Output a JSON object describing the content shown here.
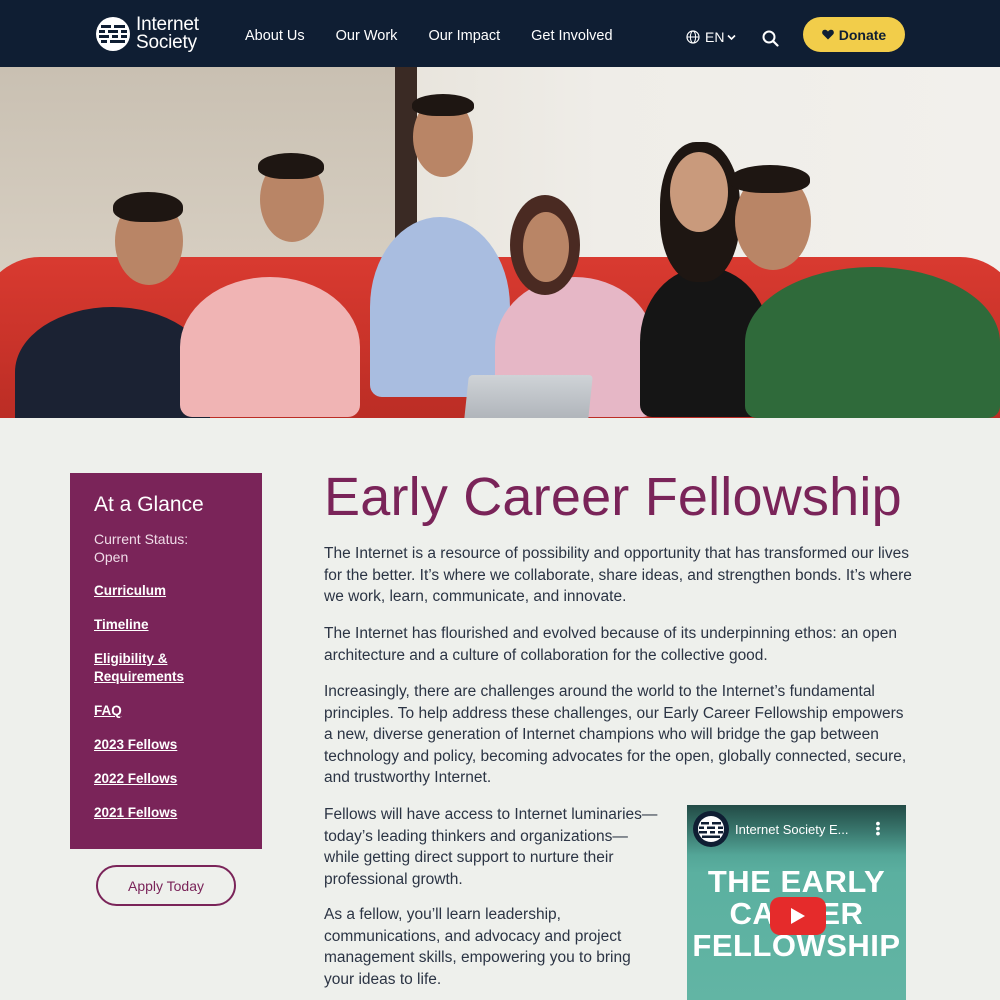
{
  "header": {
    "logo_line1": "Internet",
    "logo_line2": "Society",
    "nav": [
      "About Us",
      "Our Work",
      "Our Impact",
      "Get Involved"
    ],
    "language": "EN",
    "donate_label": "Donate"
  },
  "hero": {
    "description": "Photo of six fellows sitting on a red sofa"
  },
  "sidebar": {
    "title": "At a Glance",
    "status": "Current Status: Open",
    "links": [
      "Curriculum",
      "Timeline",
      "Eligibility & Requirements",
      "FAQ",
      "2023 Fellows",
      "2022 Fellows",
      "2021 Fellows"
    ],
    "apply_label": "Apply Today"
  },
  "main": {
    "title": "Early Career Fellowship",
    "paragraphs": [
      "The Internet is a resource of possibility and opportunity that has transformed our lives for the better. It’s where we collaborate, share ideas, and strengthen bonds. It’s where we work, learn, communicate, and innovate.",
      "The Internet has flourished and evolved because of its underpinning ethos: an open architecture and a culture of collaboration for the collective good.",
      "Increasingly, there are challenges around the world to the Internet’s fundamental principles. To help address these challenges, our Early Career Fellowship empowers a new, diverse generation of Internet champions who will bridge the gap between technology and policy, becoming advocates for the open, globally connected, secure, and trustworthy Internet.",
      "Fellows will have access to Internet luminaries—today’s leading thinkers and organizations—while getting direct support to nurture their professional growth.",
      "As a fellow, you’ll learn leadership, communications, and advocacy and project management skills, empowering you to bring your ideas to life."
    ]
  },
  "video": {
    "title": "Internet Society E...",
    "line1": "THE EARLY",
    "line2": "CAREER",
    "line3": "FELLOWSHIP"
  },
  "colors": {
    "header_bg": "#0f1e33",
    "accent": "#7a2459",
    "donate": "#f2cd4a",
    "page_bg": "#eef0ec"
  }
}
